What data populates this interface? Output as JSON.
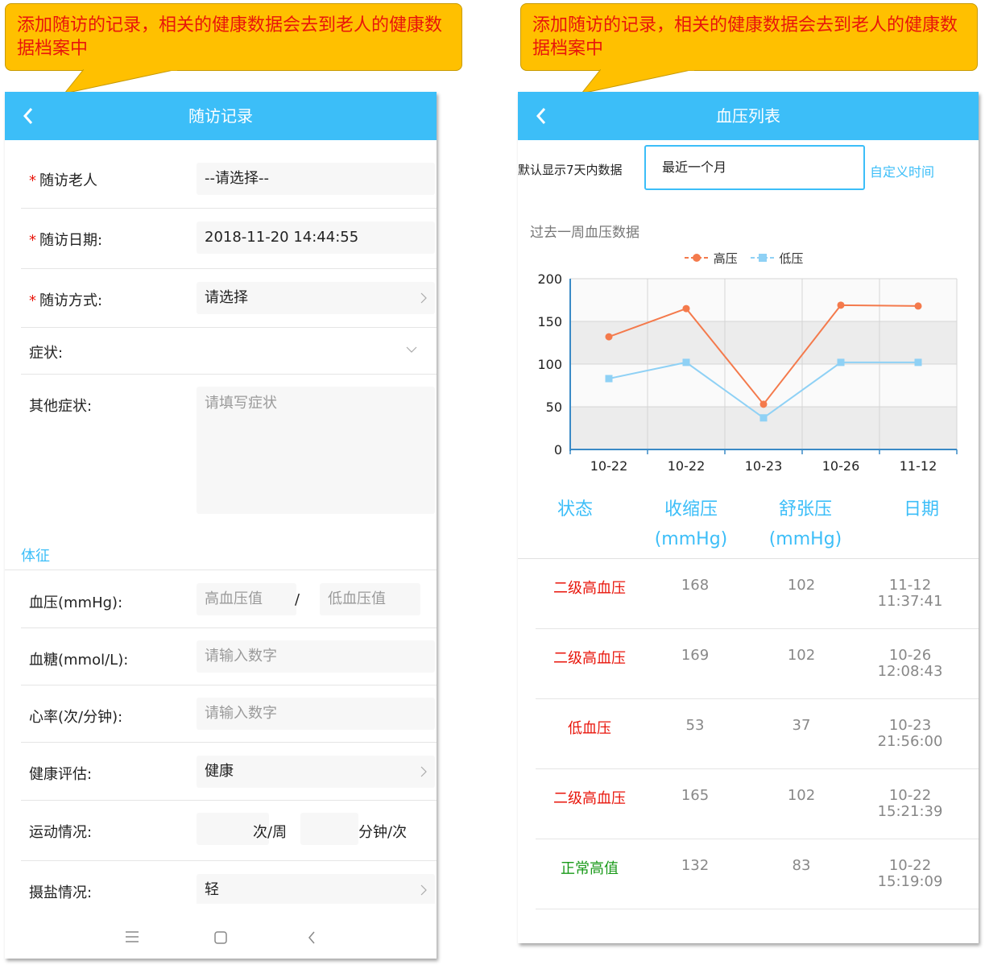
{
  "callout_left": "添加随访的记录，相关的健康数据会去到老人的健康数据档案中",
  "callout_right": "添加随访的记录，相关的健康数据会去到老人的健康数据档案中",
  "left": {
    "title": "随访记录",
    "fields": {
      "elder": {
        "label": "随访老人",
        "value": "--请选择--"
      },
      "date": {
        "label": "随访日期:",
        "value": "2018-11-20 14:44:55"
      },
      "method": {
        "label": "随访方式:",
        "value": "请选择"
      },
      "symptom": {
        "label": "症状:"
      },
      "other_symptom": {
        "label": "其他症状:",
        "placeholder": "请填写症状"
      }
    },
    "section": "体征",
    "vitals": {
      "bp": {
        "label": "血压(mmHg):",
        "high_ph": "高血压值",
        "sep": "/",
        "low_ph": "低血压值"
      },
      "sugar": {
        "label": "血糖(mmol/L):",
        "placeholder": "请输入数字"
      },
      "heart": {
        "label": "心率(次/分钟):",
        "placeholder": "请输入数字"
      },
      "assess": {
        "label": "健康评估:",
        "value": "健康"
      },
      "exercise": {
        "label": "运动情况:",
        "unit1": "次/周",
        "unit2": "分钟/次"
      },
      "salt": {
        "label": "摄盐情况:",
        "value": "轻"
      }
    }
  },
  "right": {
    "title": "血压列表",
    "filter_label": "默认显示7天内数据",
    "range_value": "最近一个月",
    "custom_time": "自定义时间",
    "chart_title": "过去一周血压数据",
    "table_headers": {
      "status": "状态",
      "systolic": "收缩压",
      "systolic_unit": "(mmHg)",
      "diastolic": "舒张压",
      "diastolic_unit": "(mmHg)",
      "date": "日期"
    },
    "rows": [
      {
        "status": "二级高血压",
        "status_color": "#e8150b",
        "sys": "168",
        "dia": "102",
        "d1": "11-12",
        "d2": "11:37:41"
      },
      {
        "status": "二级高血压",
        "status_color": "#e8150b",
        "sys": "169",
        "dia": "102",
        "d1": "10-26",
        "d2": "12:08:43"
      },
      {
        "status": "低血压",
        "status_color": "#e8150b",
        "sys": "53",
        "dia": "37",
        "d1": "10-23",
        "d2": "21:56:00"
      },
      {
        "status": "二级高血压",
        "status_color": "#e8150b",
        "sys": "165",
        "dia": "102",
        "d1": "10-22",
        "d2": "15:21:39"
      },
      {
        "status": "正常高值",
        "status_color": "#1a9a1a",
        "sys": "132",
        "dia": "83",
        "d1": "10-22",
        "d2": "15:19:09"
      }
    ]
  },
  "chart_data": {
    "type": "line",
    "title": "过去一周血压数据",
    "categories": [
      "10-22",
      "10-22",
      "10-23",
      "10-26",
      "11-12"
    ],
    "series": [
      {
        "name": "高压",
        "values": [
          132,
          165,
          53,
          169,
          168
        ],
        "color": "#f47a4c"
      },
      {
        "name": "低压",
        "values": [
          83,
          102,
          37,
          102,
          102
        ],
        "color": "#8fd1f5"
      }
    ],
    "yticks": [
      "0",
      "50",
      "100",
      "150",
      "200"
    ],
    "ylim": [
      0,
      200
    ],
    "grid": true,
    "legend": "top-center"
  },
  "colors": {
    "accent": "#3cbef8",
    "danger": "#e8150b",
    "callout": "#ffc000"
  }
}
